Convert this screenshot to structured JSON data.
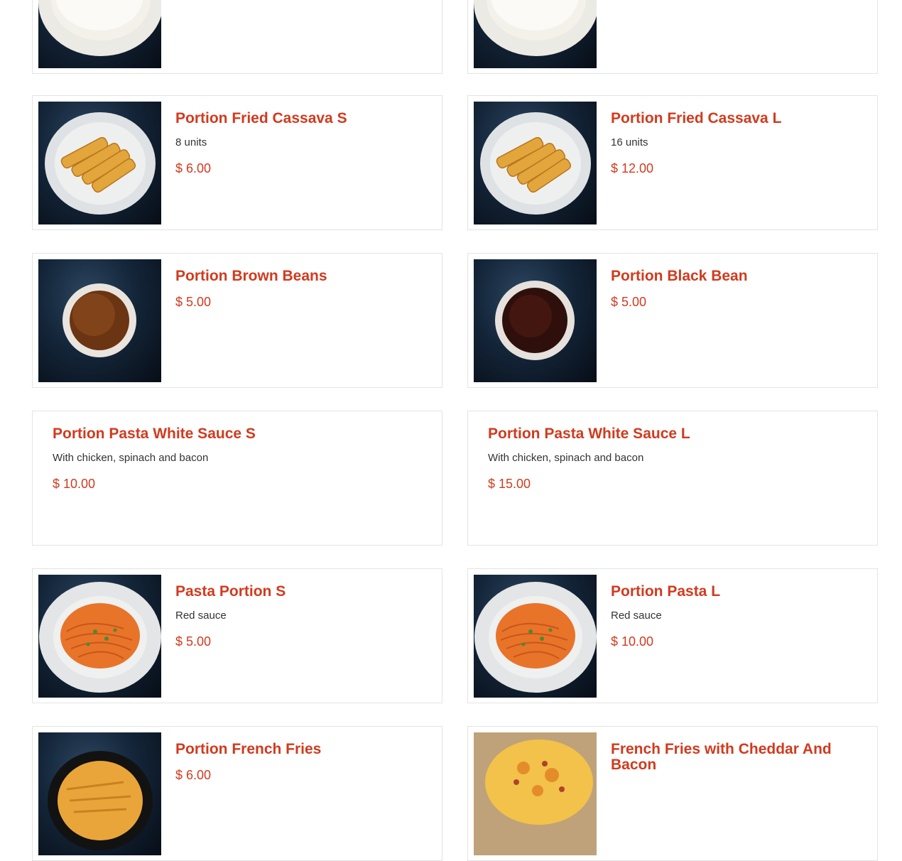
{
  "colors": {
    "accent": "#d23a1e",
    "text": "#333333",
    "card_border": "#e4e4e4"
  },
  "menu_items": [
    {
      "id": "rice-s",
      "name": "",
      "description": "",
      "price": "",
      "image": "rice-plate"
    },
    {
      "id": "rice-l",
      "name": "",
      "description": "",
      "price": "",
      "image": "rice-plate"
    },
    {
      "id": "cassava-s",
      "name": "Portion Fried Cassava S",
      "description": "8 units",
      "price": "$ 6.00",
      "image": "fried-cassava-plate"
    },
    {
      "id": "cassava-l",
      "name": "Portion Fried Cassava L",
      "description": "16 units",
      "price": "$ 12.00",
      "image": "fried-cassava-plate"
    },
    {
      "id": "brown-beans",
      "name": "Portion Brown Beans",
      "description": "",
      "price": "$ 5.00",
      "image": "brown-beans-bowl"
    },
    {
      "id": "black-bean",
      "name": "Portion Black Bean",
      "description": "",
      "price": "$ 5.00",
      "image": "black-beans-bowl"
    },
    {
      "id": "pasta-white-s",
      "name": "Portion Pasta White Sauce S",
      "description": "With chicken, spinach and bacon",
      "price": "$ 10.00",
      "image": ""
    },
    {
      "id": "pasta-white-l",
      "name": "Portion Pasta White Sauce L",
      "description": "With chicken, spinach and bacon",
      "price": "$ 15.00",
      "image": ""
    },
    {
      "id": "pasta-s",
      "name": "Pasta Portion S",
      "description": "Red sauce",
      "price": "$ 5.00",
      "image": "pasta-red-sauce-plate"
    },
    {
      "id": "pasta-l",
      "name": "Portion Pasta L",
      "description": "Red sauce",
      "price": "$ 10.00",
      "image": "pasta-red-sauce-plate"
    },
    {
      "id": "fries",
      "name": "Portion French Fries",
      "description": "",
      "price": "$ 6.00",
      "image": "french-fries-bowl"
    },
    {
      "id": "fries-cheddar",
      "name": "French Fries with Cheddar And Bacon",
      "description": "",
      "price": "",
      "image": "cheddar-bacon-fries"
    }
  ]
}
